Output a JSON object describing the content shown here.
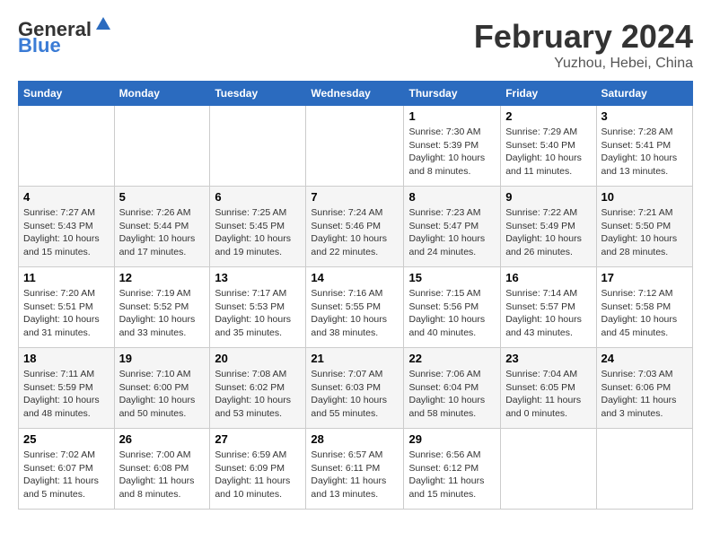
{
  "header": {
    "logo_general": "General",
    "logo_blue": "Blue",
    "month_year": "February 2024",
    "location": "Yuzhou, Hebei, China"
  },
  "weekdays": [
    "Sunday",
    "Monday",
    "Tuesday",
    "Wednesday",
    "Thursday",
    "Friday",
    "Saturday"
  ],
  "weeks": [
    [
      {
        "day": "",
        "info": ""
      },
      {
        "day": "",
        "info": ""
      },
      {
        "day": "",
        "info": ""
      },
      {
        "day": "",
        "info": ""
      },
      {
        "day": "1",
        "info": "Sunrise: 7:30 AM\nSunset: 5:39 PM\nDaylight: 10 hours\nand 8 minutes."
      },
      {
        "day": "2",
        "info": "Sunrise: 7:29 AM\nSunset: 5:40 PM\nDaylight: 10 hours\nand 11 minutes."
      },
      {
        "day": "3",
        "info": "Sunrise: 7:28 AM\nSunset: 5:41 PM\nDaylight: 10 hours\nand 13 minutes."
      }
    ],
    [
      {
        "day": "4",
        "info": "Sunrise: 7:27 AM\nSunset: 5:43 PM\nDaylight: 10 hours\nand 15 minutes."
      },
      {
        "day": "5",
        "info": "Sunrise: 7:26 AM\nSunset: 5:44 PM\nDaylight: 10 hours\nand 17 minutes."
      },
      {
        "day": "6",
        "info": "Sunrise: 7:25 AM\nSunset: 5:45 PM\nDaylight: 10 hours\nand 19 minutes."
      },
      {
        "day": "7",
        "info": "Sunrise: 7:24 AM\nSunset: 5:46 PM\nDaylight: 10 hours\nand 22 minutes."
      },
      {
        "day": "8",
        "info": "Sunrise: 7:23 AM\nSunset: 5:47 PM\nDaylight: 10 hours\nand 24 minutes."
      },
      {
        "day": "9",
        "info": "Sunrise: 7:22 AM\nSunset: 5:49 PM\nDaylight: 10 hours\nand 26 minutes."
      },
      {
        "day": "10",
        "info": "Sunrise: 7:21 AM\nSunset: 5:50 PM\nDaylight: 10 hours\nand 28 minutes."
      }
    ],
    [
      {
        "day": "11",
        "info": "Sunrise: 7:20 AM\nSunset: 5:51 PM\nDaylight: 10 hours\nand 31 minutes."
      },
      {
        "day": "12",
        "info": "Sunrise: 7:19 AM\nSunset: 5:52 PM\nDaylight: 10 hours\nand 33 minutes."
      },
      {
        "day": "13",
        "info": "Sunrise: 7:17 AM\nSunset: 5:53 PM\nDaylight: 10 hours\nand 35 minutes."
      },
      {
        "day": "14",
        "info": "Sunrise: 7:16 AM\nSunset: 5:55 PM\nDaylight: 10 hours\nand 38 minutes."
      },
      {
        "day": "15",
        "info": "Sunrise: 7:15 AM\nSunset: 5:56 PM\nDaylight: 10 hours\nand 40 minutes."
      },
      {
        "day": "16",
        "info": "Sunrise: 7:14 AM\nSunset: 5:57 PM\nDaylight: 10 hours\nand 43 minutes."
      },
      {
        "day": "17",
        "info": "Sunrise: 7:12 AM\nSunset: 5:58 PM\nDaylight: 10 hours\nand 45 minutes."
      }
    ],
    [
      {
        "day": "18",
        "info": "Sunrise: 7:11 AM\nSunset: 5:59 PM\nDaylight: 10 hours\nand 48 minutes."
      },
      {
        "day": "19",
        "info": "Sunrise: 7:10 AM\nSunset: 6:00 PM\nDaylight: 10 hours\nand 50 minutes."
      },
      {
        "day": "20",
        "info": "Sunrise: 7:08 AM\nSunset: 6:02 PM\nDaylight: 10 hours\nand 53 minutes."
      },
      {
        "day": "21",
        "info": "Sunrise: 7:07 AM\nSunset: 6:03 PM\nDaylight: 10 hours\nand 55 minutes."
      },
      {
        "day": "22",
        "info": "Sunrise: 7:06 AM\nSunset: 6:04 PM\nDaylight: 10 hours\nand 58 minutes."
      },
      {
        "day": "23",
        "info": "Sunrise: 7:04 AM\nSunset: 6:05 PM\nDaylight: 11 hours\nand 0 minutes."
      },
      {
        "day": "24",
        "info": "Sunrise: 7:03 AM\nSunset: 6:06 PM\nDaylight: 11 hours\nand 3 minutes."
      }
    ],
    [
      {
        "day": "25",
        "info": "Sunrise: 7:02 AM\nSunset: 6:07 PM\nDaylight: 11 hours\nand 5 minutes."
      },
      {
        "day": "26",
        "info": "Sunrise: 7:00 AM\nSunset: 6:08 PM\nDaylight: 11 hours\nand 8 minutes."
      },
      {
        "day": "27",
        "info": "Sunrise: 6:59 AM\nSunset: 6:09 PM\nDaylight: 11 hours\nand 10 minutes."
      },
      {
        "day": "28",
        "info": "Sunrise: 6:57 AM\nSunset: 6:11 PM\nDaylight: 11 hours\nand 13 minutes."
      },
      {
        "day": "29",
        "info": "Sunrise: 6:56 AM\nSunset: 6:12 PM\nDaylight: 11 hours\nand 15 minutes."
      },
      {
        "day": "",
        "info": ""
      },
      {
        "day": "",
        "info": ""
      }
    ]
  ]
}
